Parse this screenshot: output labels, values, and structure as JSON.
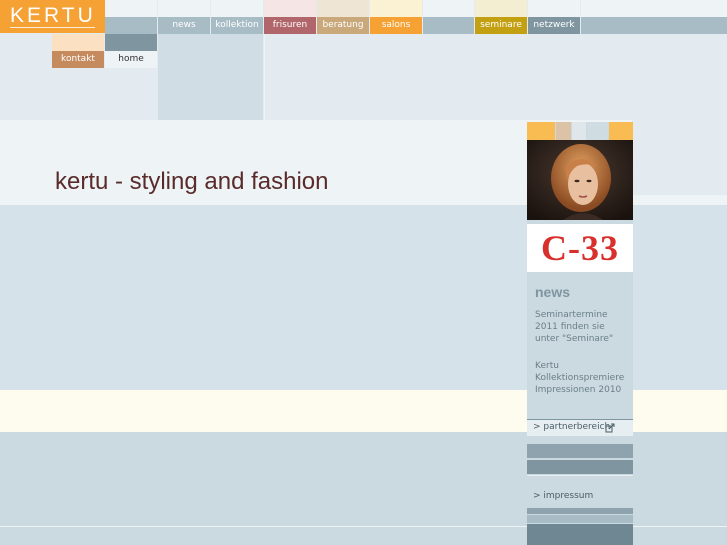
{
  "logo": "KERTU",
  "nav": {
    "news": "news",
    "kollektion": "kollektion",
    "frisuren": "frisuren",
    "beratung": "beratung",
    "salons": "salons",
    "seminare": "seminare",
    "netzwerk": "netzwerk",
    "kontakt": "kontakt",
    "home": "home"
  },
  "main": {
    "title": "kertu - styling and fashion"
  },
  "sidebar": {
    "brand": "C-33",
    "news_heading": "news",
    "news_items": [
      "Seminartermine 2011 finden sie unter \"Seminare\"",
      "Kertu Kollektionspremiere Impressionen 2010"
    ],
    "partner_link": "> partnerbereich",
    "impressum_link": "> impressum"
  },
  "colors": {
    "orange": "#f5a134",
    "rose": "#b0666a",
    "tan": "#c9a97c",
    "olive": "#c2a011",
    "slate": "#7f96a1",
    "title": "#5a2b2b"
  }
}
